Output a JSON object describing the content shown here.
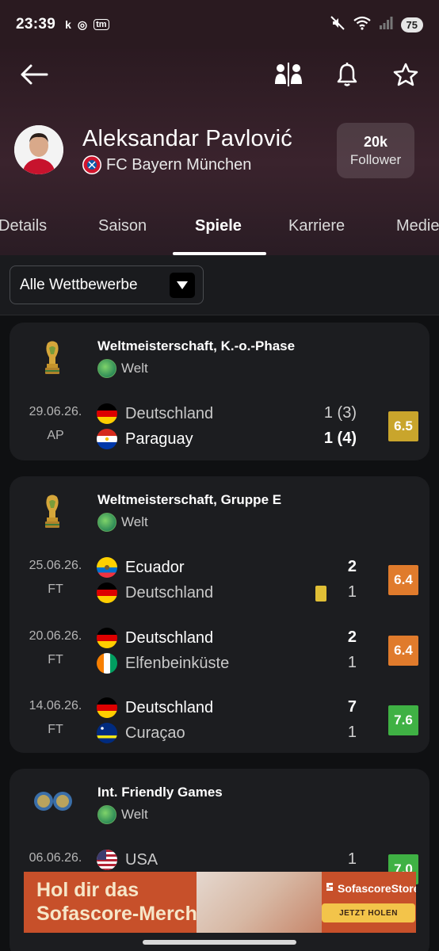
{
  "status_bar": {
    "time": "23:39",
    "apps": [
      "k",
      "◎",
      "tm"
    ],
    "battery": "75"
  },
  "header": {
    "player_name": "Aleksandar Pavlović",
    "team": "FC Bayern München",
    "follower_count": "20k",
    "follower_label": "Follower"
  },
  "tabs": [
    {
      "label": "Details"
    },
    {
      "label": "Saison"
    },
    {
      "label": "Spiele"
    },
    {
      "label": "Karriere"
    },
    {
      "label": "Medien"
    }
  ],
  "filter": {
    "label": "Alle Wettbewerbe"
  },
  "competitions": [
    {
      "title": "Weltmeisterschaft, K.-o.-Phase",
      "region": "Welt",
      "matches": [
        {
          "date": "29.06.26.",
          "status": "AP",
          "home": "Deutschland",
          "away": "Paraguay",
          "home_score": "1  (3)",
          "away_score": "1  (4)",
          "rating": "6.5",
          "rating_color": "#c9a52c"
        }
      ]
    },
    {
      "title": "Weltmeisterschaft, Gruppe E",
      "region": "Welt",
      "matches": [
        {
          "date": "25.06.26.",
          "status": "FT",
          "home": "Ecuador",
          "away": "Deutschland",
          "home_score": "2",
          "away_score": "1",
          "rating": "6.4",
          "rating_color": "#e07b2c"
        },
        {
          "date": "20.06.26.",
          "status": "FT",
          "home": "Deutschland",
          "away": "Elfenbeinküste",
          "home_score": "2",
          "away_score": "1",
          "rating": "6.4",
          "rating_color": "#e07b2c"
        },
        {
          "date": "14.06.26.",
          "status": "FT",
          "home": "Deutschland",
          "away": "Curaçao",
          "home_score": "7",
          "away_score": "1",
          "rating": "7.6",
          "rating_color": "#3fb144"
        }
      ]
    },
    {
      "title": "Int. Friendly Games",
      "region": "Welt",
      "matches": [
        {
          "date": "06.06.26.",
          "status": "",
          "home": "USA",
          "away": "",
          "home_score": "1",
          "away_score": "",
          "rating": "7.0",
          "rating_color": "#3fb144"
        }
      ]
    }
  ],
  "ad": {
    "headline_line1": "Hol dir das",
    "headline_line2": "Sofascore-Merch",
    "store_label": "SofascoreStore",
    "cta": "JETZT HOLEN"
  },
  "icons": {
    "back": "arrow-left-icon",
    "compare": "compare-players-icon",
    "notifications": "bell-icon",
    "favorite": "star-icon"
  }
}
